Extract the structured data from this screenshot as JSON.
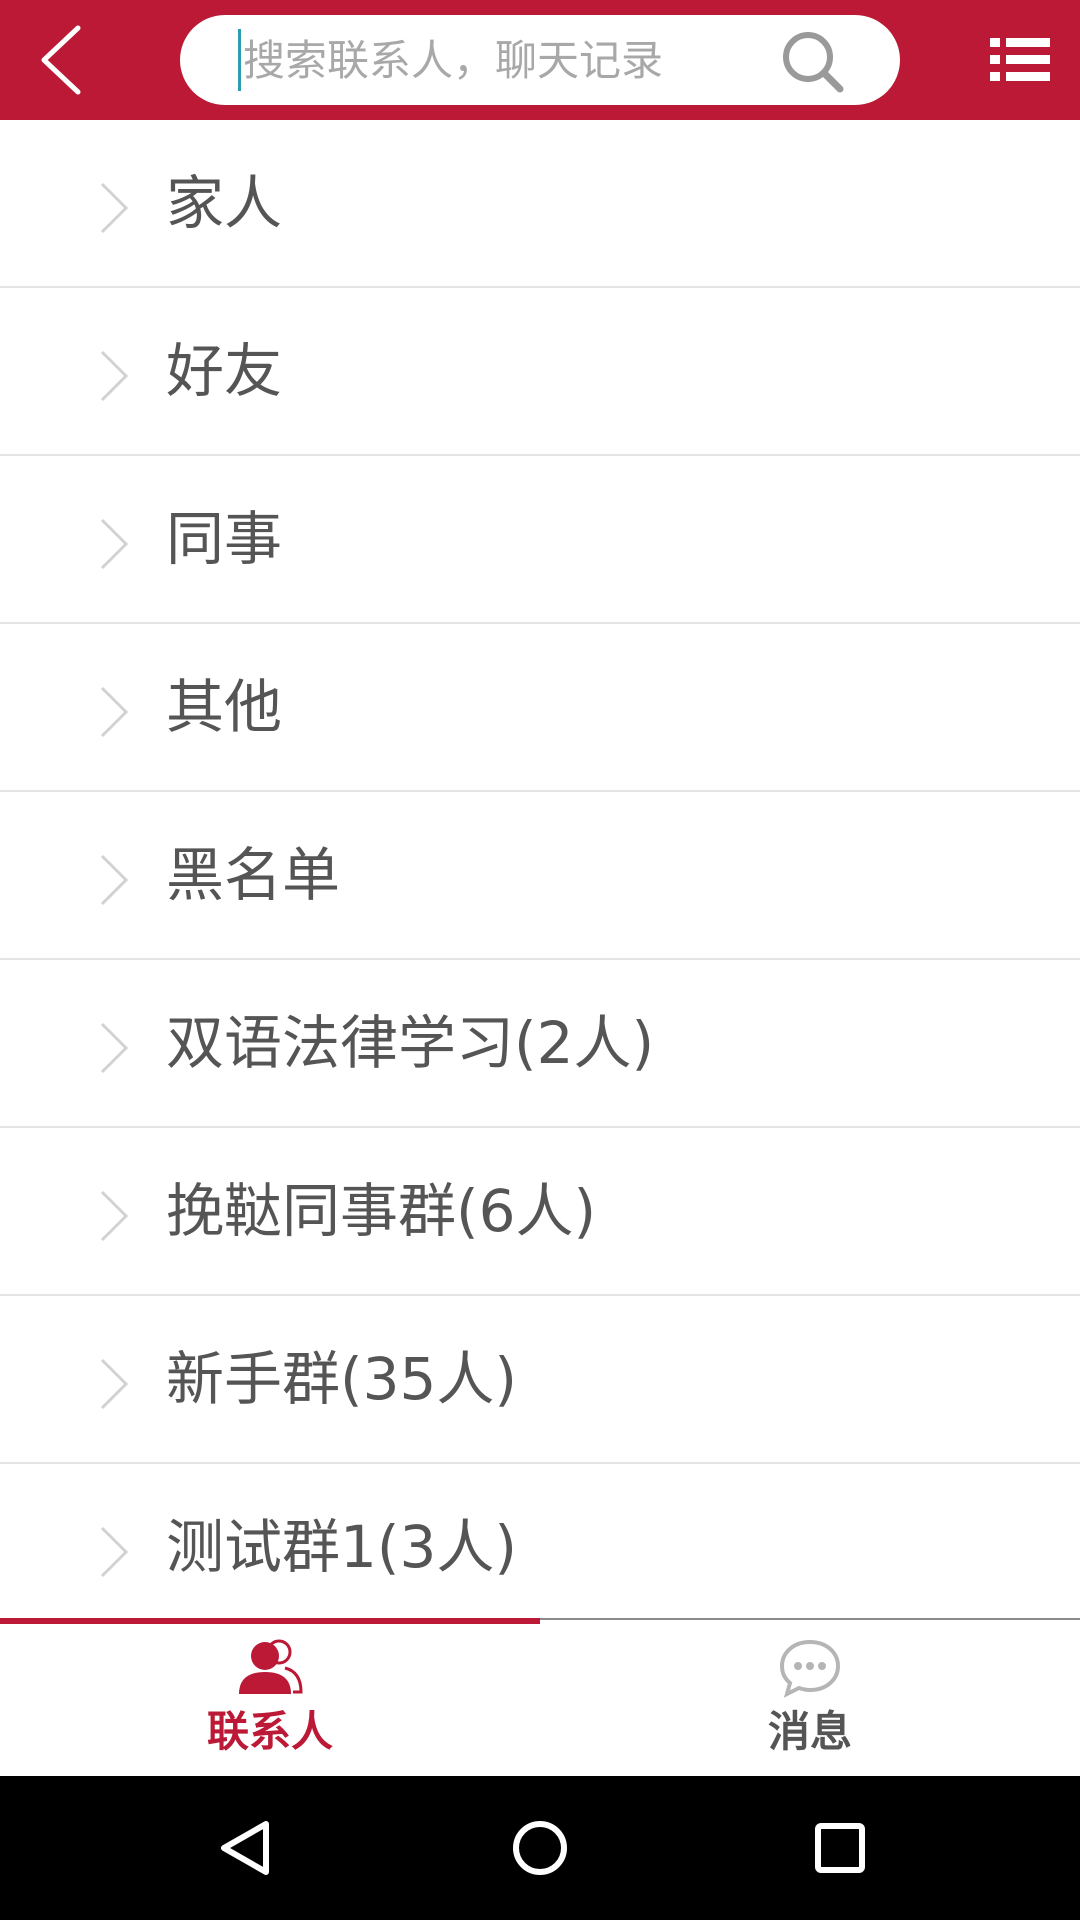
{
  "header": {
    "search_placeholder": "搜索联系人，聊天记录",
    "search_value": "",
    "back_icon": "chevron-left-icon",
    "search_icon": "magnifier-icon",
    "menu_icon": "list-menu-icon"
  },
  "groups": [
    {
      "label": "家人"
    },
    {
      "label": "好友"
    },
    {
      "label": "同事"
    },
    {
      "label": "其他"
    },
    {
      "label": "黑名单"
    },
    {
      "label": "双语法律学习(2人)"
    },
    {
      "label": "挽鞑同事群(6人)"
    },
    {
      "label": "新手群(35人)"
    },
    {
      "label": "测试群1(3人)"
    }
  ],
  "tabs": [
    {
      "label": "联系人",
      "icon": "contacts-icon",
      "active": true
    },
    {
      "label": "消息",
      "icon": "chat-bubble-icon",
      "active": false
    }
  ],
  "colors": {
    "brand": "#bb1935",
    "text": "#555555",
    "divider": "#e4e4e4"
  }
}
